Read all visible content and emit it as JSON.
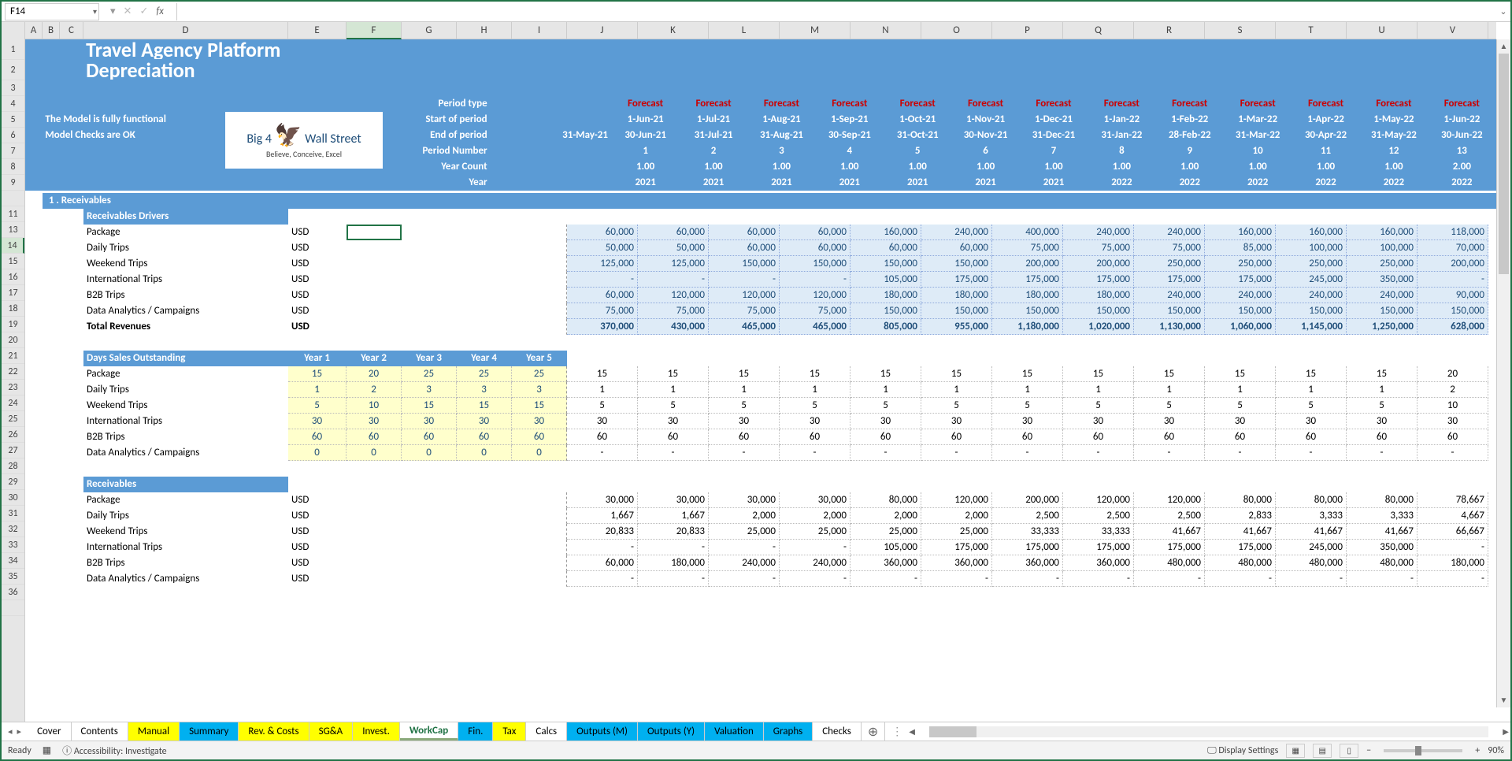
{
  "nameBox": "F14",
  "title1": "Travel Agency Platform",
  "title2": "Depreciation",
  "status1": "The Model is fully functional",
  "status2": "Model Checks are OK",
  "logo": {
    "line1": "Big 4",
    "line2": "Wall Street",
    "tag": "Believe, Conceive, Excel"
  },
  "periodLabels": {
    "type": "Period type",
    "start": "Start of period",
    "end": "End of period",
    "num": "Period Number",
    "ycount": "Year Count",
    "year": "Year"
  },
  "firstDate": "31-May-21",
  "cols": [
    "A",
    "B",
    "C",
    "D",
    "E",
    "F",
    "G",
    "H",
    "I",
    "J",
    "K",
    "L",
    "M",
    "N",
    "O",
    "P",
    "Q",
    "R",
    "S",
    "T",
    "U",
    "V"
  ],
  "rows": [
    "1",
    "2",
    "3",
    "4",
    "5",
    "6",
    "7",
    "8",
    "9",
    "",
    "11",
    "13",
    "14",
    "15",
    "16",
    "17",
    "18",
    "19",
    "20",
    "21",
    "22",
    "23",
    "24",
    "25",
    "26",
    "27",
    "28",
    "29",
    "30",
    "31",
    "32",
    "33",
    "34",
    "35",
    "36",
    ""
  ],
  "forecast": "Forecast",
  "periods": {
    "start": [
      "1-Jun-21",
      "1-Jul-21",
      "1-Aug-21",
      "1-Sep-21",
      "1-Oct-21",
      "1-Nov-21",
      "1-Dec-21",
      "1-Jan-22",
      "1-Feb-22",
      "1-Mar-22",
      "1-Apr-22",
      "1-May-22",
      "1-Jun-22"
    ],
    "end": [
      "30-Jun-21",
      "31-Jul-21",
      "31-Aug-21",
      "30-Sep-21",
      "31-Oct-21",
      "30-Nov-21",
      "31-Dec-21",
      "31-Jan-22",
      "28-Feb-22",
      "31-Mar-22",
      "30-Apr-22",
      "31-May-22",
      "30-Jun-22"
    ],
    "num": [
      "1",
      "2",
      "3",
      "4",
      "5",
      "6",
      "7",
      "8",
      "9",
      "10",
      "11",
      "12",
      "13"
    ],
    "ycount": [
      "1.00",
      "1.00",
      "1.00",
      "1.00",
      "1.00",
      "1.00",
      "1.00",
      "1.00",
      "1.00",
      "1.00",
      "1.00",
      "1.00",
      "2.00"
    ],
    "year": [
      "2021",
      "2021",
      "2021",
      "2021",
      "2021",
      "2021",
      "2021",
      "2022",
      "2022",
      "2022",
      "2022",
      "2022",
      "2022"
    ]
  },
  "sec1": "1 .  Receivables",
  "sub1": "Receivables Drivers",
  "usd": "USD",
  "drivers": [
    "Package",
    "Daily Trips",
    "Weekend Trips",
    "International Trips",
    "B2B Trips",
    "Data Analytics / Campaigns"
  ],
  "totalRevLabel": "Total Revenues",
  "revData": [
    [
      "60,000",
      "60,000",
      "60,000",
      "60,000",
      "160,000",
      "240,000",
      "400,000",
      "240,000",
      "240,000",
      "160,000",
      "160,000",
      "160,000",
      "118,000"
    ],
    [
      "50,000",
      "50,000",
      "60,000",
      "60,000",
      "60,000",
      "60,000",
      "75,000",
      "75,000",
      "75,000",
      "85,000",
      "100,000",
      "100,000",
      "70,000"
    ],
    [
      "125,000",
      "125,000",
      "150,000",
      "150,000",
      "150,000",
      "150,000",
      "200,000",
      "200,000",
      "250,000",
      "250,000",
      "250,000",
      "250,000",
      "200,000"
    ],
    [
      "-",
      "-",
      "-",
      "-",
      "105,000",
      "175,000",
      "175,000",
      "175,000",
      "175,000",
      "175,000",
      "245,000",
      "350,000",
      "-"
    ],
    [
      "60,000",
      "120,000",
      "120,000",
      "120,000",
      "180,000",
      "180,000",
      "180,000",
      "180,000",
      "240,000",
      "240,000",
      "240,000",
      "240,000",
      "90,000"
    ],
    [
      "75,000",
      "75,000",
      "75,000",
      "75,000",
      "150,000",
      "150,000",
      "150,000",
      "150,000",
      "150,000",
      "150,000",
      "150,000",
      "150,000",
      "150,000"
    ]
  ],
  "totalRev": [
    "370,000",
    "430,000",
    "465,000",
    "465,000",
    "805,000",
    "955,000",
    "1,180,000",
    "1,020,000",
    "1,130,000",
    "1,060,000",
    "1,145,000",
    "1,250,000",
    "628,000"
  ],
  "dsoHead": "Days Sales Outstanding",
  "yearHeads": [
    "Year 1",
    "Year 2",
    "Year 3",
    "Year 4",
    "Year 5"
  ],
  "dsoYears": [
    [
      "15",
      "20",
      "25",
      "25",
      "25"
    ],
    [
      "1",
      "2",
      "3",
      "3",
      "3"
    ],
    [
      "5",
      "10",
      "15",
      "15",
      "15"
    ],
    [
      "30",
      "30",
      "30",
      "30",
      "30"
    ],
    [
      "60",
      "60",
      "60",
      "60",
      "60"
    ],
    [
      "0",
      "0",
      "0",
      "0",
      "0"
    ]
  ],
  "dsoPeriods": [
    [
      "15",
      "15",
      "15",
      "15",
      "15",
      "15",
      "15",
      "15",
      "15",
      "15",
      "15",
      "15",
      "20"
    ],
    [
      "1",
      "1",
      "1",
      "1",
      "1",
      "1",
      "1",
      "1",
      "1",
      "1",
      "1",
      "1",
      "2"
    ],
    [
      "5",
      "5",
      "5",
      "5",
      "5",
      "5",
      "5",
      "5",
      "5",
      "5",
      "5",
      "5",
      "10"
    ],
    [
      "30",
      "30",
      "30",
      "30",
      "30",
      "30",
      "30",
      "30",
      "30",
      "30",
      "30",
      "30",
      "30"
    ],
    [
      "60",
      "60",
      "60",
      "60",
      "60",
      "60",
      "60",
      "60",
      "60",
      "60",
      "60",
      "60",
      "60"
    ],
    [
      "-",
      "-",
      "-",
      "-",
      "-",
      "-",
      "-",
      "-",
      "-",
      "-",
      "-",
      "-",
      "-"
    ]
  ],
  "sub3": "Receivables",
  "recvData": [
    [
      "30,000",
      "30,000",
      "30,000",
      "30,000",
      "80,000",
      "120,000",
      "200,000",
      "120,000",
      "120,000",
      "80,000",
      "80,000",
      "80,000",
      "78,667"
    ],
    [
      "1,667",
      "1,667",
      "2,000",
      "2,000",
      "2,000",
      "2,000",
      "2,500",
      "2,500",
      "2,500",
      "2,833",
      "3,333",
      "3,333",
      "4,667"
    ],
    [
      "20,833",
      "20,833",
      "25,000",
      "25,000",
      "25,000",
      "25,000",
      "33,333",
      "33,333",
      "41,667",
      "41,667",
      "41,667",
      "41,667",
      "66,667"
    ],
    [
      "-",
      "-",
      "-",
      "-",
      "105,000",
      "175,000",
      "175,000",
      "175,000",
      "175,000",
      "175,000",
      "245,000",
      "350,000",
      "-"
    ],
    [
      "60,000",
      "180,000",
      "240,000",
      "240,000",
      "360,000",
      "360,000",
      "360,000",
      "360,000",
      "480,000",
      "480,000",
      "480,000",
      "480,000",
      "180,000"
    ],
    [
      "-",
      "-",
      "-",
      "-",
      "-",
      "-",
      "-",
      "-",
      "-",
      "-",
      "-",
      "-",
      "-"
    ]
  ],
  "tabs": [
    {
      "n": "Cover",
      "c": ""
    },
    {
      "n": "Contents",
      "c": ""
    },
    {
      "n": "Manual",
      "c": "yellow"
    },
    {
      "n": "Summary",
      "c": "cyan"
    },
    {
      "n": "Rev. & Costs",
      "c": "yellow"
    },
    {
      "n": "SG&A",
      "c": "yellow"
    },
    {
      "n": "Invest.",
      "c": "yellow"
    },
    {
      "n": "WorkCap",
      "c": "active"
    },
    {
      "n": "Fin.",
      "c": "cyan"
    },
    {
      "n": "Tax",
      "c": "yellow"
    },
    {
      "n": "Calcs",
      "c": ""
    },
    {
      "n": "Outputs (M)",
      "c": "cyan"
    },
    {
      "n": "Outputs (Y)",
      "c": "cyan"
    },
    {
      "n": "Valuation",
      "c": "cyan"
    },
    {
      "n": "Graphs",
      "c": "cyan"
    },
    {
      "n": "Checks",
      "c": ""
    }
  ],
  "statusBar": {
    "ready": "Ready",
    "access": "Accessibility: Investigate",
    "display": "Display Settings",
    "zoom": "90%"
  }
}
